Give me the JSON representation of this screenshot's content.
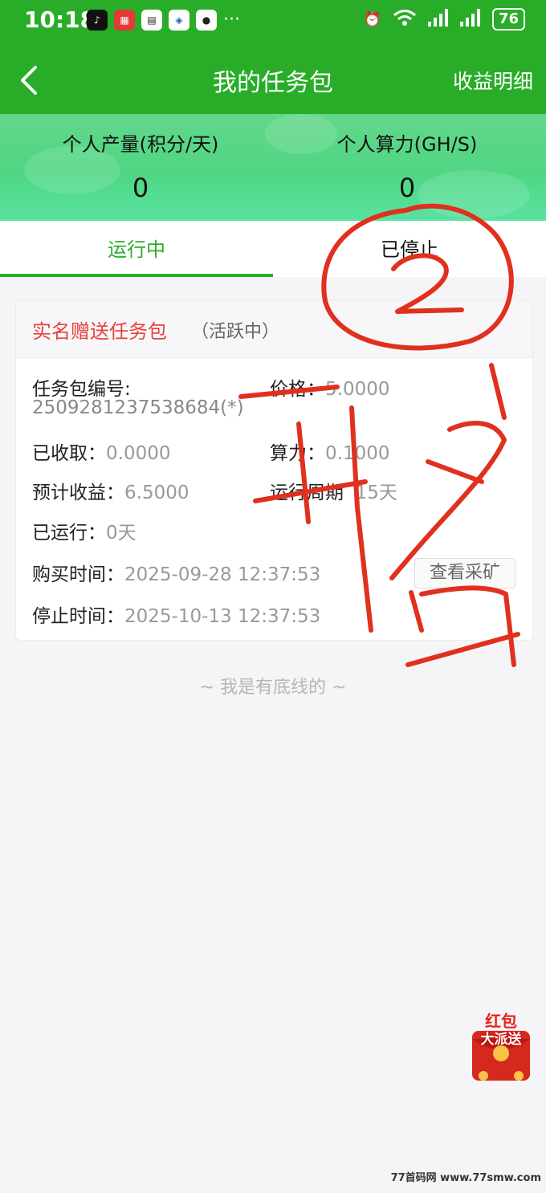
{
  "status_bar": {
    "time": "10:18",
    "battery": "76",
    "more": "···"
  },
  "nav": {
    "title": "我的任务包",
    "right_link": "收益明细"
  },
  "stats": {
    "output_label": "个人产量(积分/天)",
    "output_value": "0",
    "power_label": "个人算力(GH/S)",
    "power_value": "0"
  },
  "tabs": [
    {
      "label": "运行中",
      "active": true
    },
    {
      "label": "已停止",
      "active": false
    }
  ],
  "card": {
    "title": "实名赠送任务包",
    "status": "（活跃中）",
    "package_no_label": "任务包编号:",
    "package_no": "2509281237538684(*)",
    "price_label": "价格：",
    "price": "5.0000",
    "collected_label": "已收取：",
    "collected": "0.0000",
    "power_label": "算力：",
    "power": "0.1000",
    "expected_label": "预计收益：",
    "expected": "6.5000",
    "cycle_label": "运行周期",
    "cycle": "15天",
    "running_label": "已运行：",
    "running": "0天",
    "buy_time_label": "购买时间：",
    "buy_time": "2025-09-28 12:37:53",
    "stop_time_label": "停止时间：",
    "stop_time": "2025-10-13 12:37:53",
    "detail_button": "查看采矿"
  },
  "footer": "~ 我是有底线的 ~",
  "redpack": {
    "line1": "红包",
    "line2": "大派送"
  },
  "watermark": "77首码网 www.77smw.com",
  "colors": {
    "primary": "#29ad29",
    "accent_red": "#e8413a",
    "ink": "#e0301e"
  }
}
